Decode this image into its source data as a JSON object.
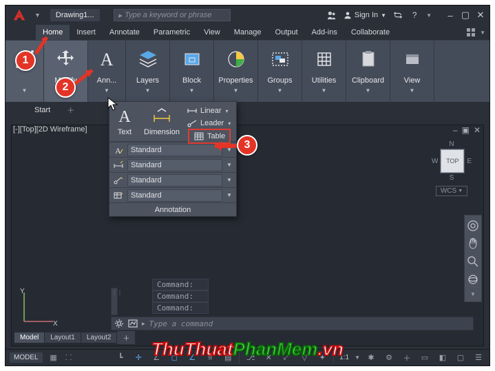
{
  "title": {
    "document": "Drawing1...",
    "search_placeholder": "Type a keyword or phrase",
    "signin": "Sign In"
  },
  "tabs": {
    "items": [
      "Home",
      "Insert",
      "Annotate",
      "Parametric",
      "View",
      "Manage",
      "Output",
      "Add-ins",
      "Collaborate"
    ],
    "active_index": 0
  },
  "ribbon": {
    "panels": [
      {
        "label": ""
      },
      {
        "label": "Modify"
      },
      {
        "label": "Ann..."
      },
      {
        "label": "Layers"
      },
      {
        "label": "Block"
      },
      {
        "label": "Properties"
      },
      {
        "label": "Groups"
      },
      {
        "label": "Utilities"
      },
      {
        "label": "Clipboard"
      },
      {
        "label": "View"
      }
    ]
  },
  "filetabs": {
    "start": "Start"
  },
  "dropdown": {
    "text": "Text",
    "dimension": "Dimension",
    "linear": "Linear",
    "leader": "Leader",
    "table": "Table",
    "rows": [
      "Standard",
      "Standard",
      "Standard",
      "Standard"
    ],
    "footer": "Annotation"
  },
  "viewport": {
    "label": "[-][Top][2D Wireframe]",
    "navcube": {
      "n": "N",
      "face": "TOP",
      "s": "S",
      "e": "E",
      "w": "W",
      "wcs": "WCS"
    }
  },
  "command": {
    "hist": [
      "Command:",
      "Command:",
      "Command:"
    ],
    "placeholder": "Type a command"
  },
  "layouts": [
    "Model",
    "Layout1",
    "Layout2"
  ],
  "status": {
    "model": "MODEL",
    "scale": "1:1"
  },
  "badges": {
    "b1": "1",
    "b2": "2",
    "b3": "3"
  },
  "watermark": {
    "a": "ThuThuat",
    "b": "PhanMem",
    "c": ".vn"
  }
}
